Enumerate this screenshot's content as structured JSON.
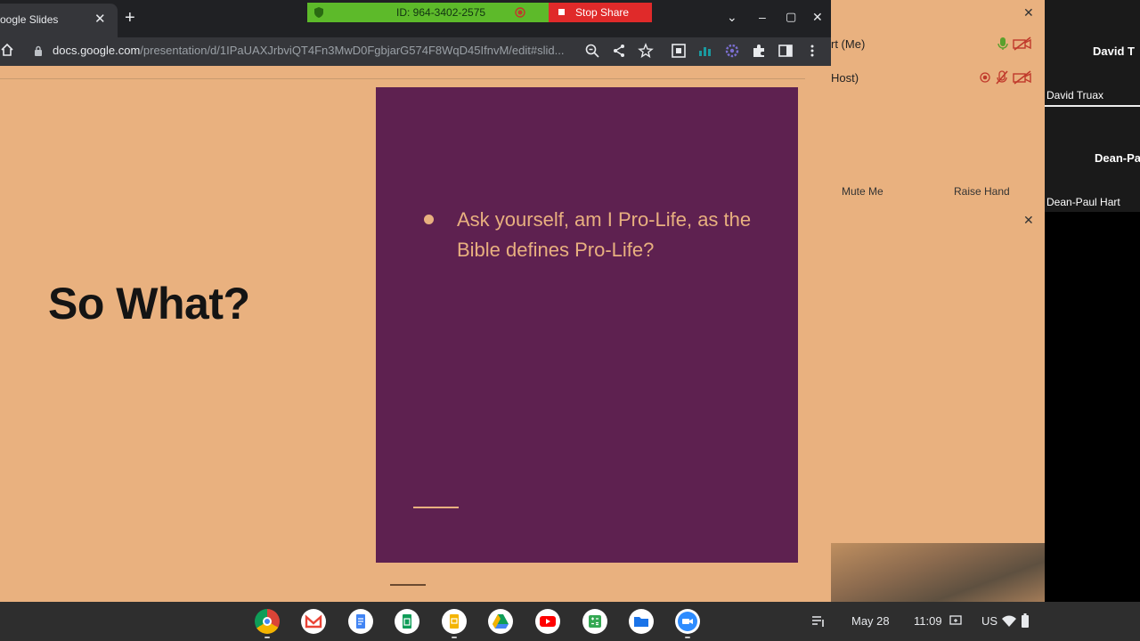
{
  "browser": {
    "tab_title": "oogle Slides",
    "tab_close": "✕",
    "new_tab": "+",
    "url_domain": "docs.google.com",
    "url_path": "/presentation/d/1IPaUAXJrbviQT4Fn3MwD0FgbjarG574F8WqD45IfnvM/edit#slid...",
    "win_menu": "⌄",
    "win_min": "–",
    "win_max": "▢",
    "win_close": "✕"
  },
  "sharing": {
    "meeting_id": "ID: 964-3402-2575",
    "stop_label": "Stop Share"
  },
  "slide": {
    "title": "So What?",
    "bullet": "Ask yourself, am I Pro-Life, as the Bible defines Pro-Life?"
  },
  "zoom_panel": {
    "close1": "✕",
    "close2": "✕",
    "participant_me": "rt (Me)",
    "participant_host": "Host)",
    "mute_me": "Mute Me",
    "raise_hand": "Raise Hand"
  },
  "gallery": {
    "tile1_big": "David T",
    "tile1_small": "David Truax",
    "tile2_big": "Dean-Pa",
    "tile2_small": "Dean-Paul Hart"
  },
  "shelf": {
    "date": "May 28",
    "time": "11:09",
    "locale": "US"
  },
  "colors": {
    "slide_bg": "#e9b17f",
    "purple_panel": "#5e2150",
    "accent": "#e8b07f",
    "share_green": "#5dba2a",
    "stop_red": "#e02a2a"
  }
}
